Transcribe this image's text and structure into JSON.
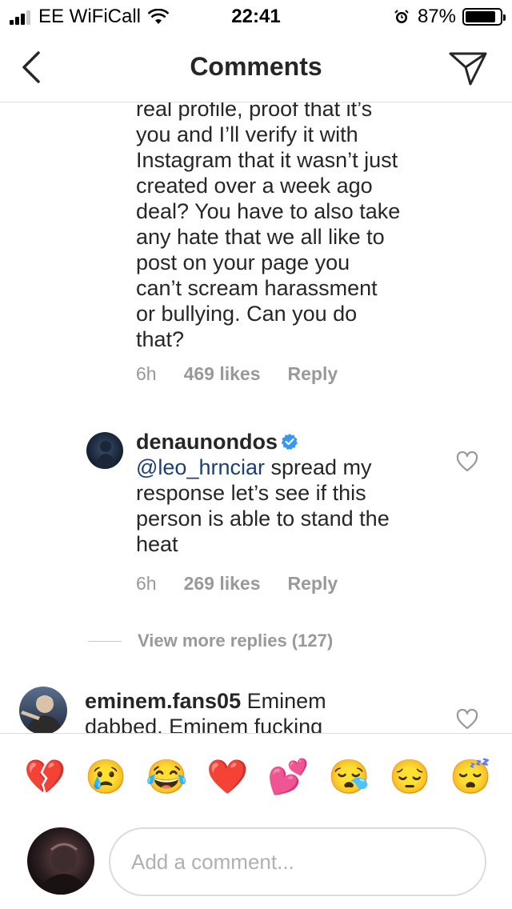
{
  "status_bar": {
    "carrier": "EE WiFiCall",
    "time": "22:41",
    "battery_percent": "87%",
    "battery_level": 0.87,
    "signal_bars_filled": 3,
    "signal_bars_total": 4,
    "icons": [
      "signal-icon",
      "wifi-icon",
      "alarm-icon",
      "battery-icon"
    ]
  },
  "header": {
    "title": "Comments",
    "back_icon": "chevron-left-icon",
    "send_icon": "paper-plane-icon"
  },
  "comments": [
    {
      "text_lines": [
        "real profile, proof that it’s",
        "you and I’ll verify it with",
        "Instagram that it wasn’t just",
        "created over a week ago",
        "deal? You have to also take",
        "any hate that we all like to",
        "post on your page you",
        "can’t scream harassment",
        "or bullying. Can you do",
        "that?"
      ],
      "time": "6h",
      "likes": "469 likes",
      "reply": "Reply"
    },
    {
      "username": "denaunondos",
      "verified": true,
      "mention": "@leo_hrnciar",
      "text_first_line_rest": " spread my",
      "text_lines": [
        "response let’s see if this",
        "person is able to stand the",
        "heat"
      ],
      "time": "6h",
      "likes": "269 likes",
      "reply": "Reply"
    },
    {
      "username": "eminem.fans05",
      "text_first_line_rest": " Eminem",
      "text_lines": [
        "dabbed. Eminem fucking"
      ]
    }
  ],
  "view_more": "View more replies (127)",
  "emoji_bar": [
    "💔",
    "😢",
    "😂",
    "❤️",
    "💕",
    "😪",
    "😔",
    "😴"
  ],
  "input": {
    "placeholder": "Add a comment..."
  },
  "colors": {
    "text": "#262626",
    "muted": "#999999",
    "mention": "#1a3e76",
    "verified": "#3897f0",
    "divider": "#dbdbdb"
  }
}
